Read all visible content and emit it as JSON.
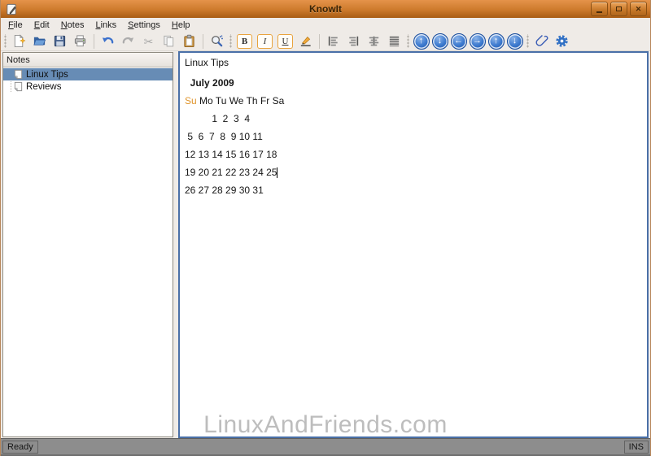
{
  "window": {
    "title": "KnowIt",
    "controls": [
      {
        "name": "minimize-button",
        "icon": "minimize-icon"
      },
      {
        "name": "maximize-button",
        "icon": "maximize-icon"
      },
      {
        "name": "close-button",
        "icon": "close-icon"
      }
    ]
  },
  "menubar": {
    "items": [
      {
        "label": "File"
      },
      {
        "label": "Edit"
      },
      {
        "label": "Notes"
      },
      {
        "label": "Links"
      },
      {
        "label": "Settings"
      },
      {
        "label": "Help"
      }
    ]
  },
  "toolbar": {
    "groups": [
      {
        "lead": "grip",
        "items": [
          {
            "name": "new-note-button",
            "icon": "new-note-icon",
            "enabled": true
          },
          {
            "name": "open-button",
            "icon": "folder-open-icon",
            "enabled": true
          },
          {
            "name": "save-button",
            "icon": "save-icon",
            "enabled": true
          },
          {
            "name": "print-button",
            "icon": "print-icon",
            "enabled": true
          }
        ]
      },
      {
        "lead": "sep",
        "items": [
          {
            "name": "undo-button",
            "icon": "undo-icon",
            "enabled": true
          },
          {
            "name": "redo-button",
            "icon": "redo-icon",
            "enabled": false
          },
          {
            "name": "cut-button",
            "icon": "cut-icon",
            "enabled": false
          },
          {
            "name": "copy-button",
            "icon": "copy-icon",
            "enabled": false
          },
          {
            "name": "paste-button",
            "icon": "paste-icon",
            "enabled": true
          }
        ]
      },
      {
        "lead": "sep",
        "items": [
          {
            "name": "find-button",
            "icon": "find-icon",
            "enabled": true
          }
        ]
      },
      {
        "lead": "grip",
        "items": [
          {
            "name": "bold-button",
            "icon": "bold-icon",
            "label": "B",
            "enabled": true,
            "toggled": true
          },
          {
            "name": "italic-button",
            "icon": "italic-icon",
            "label": "I",
            "enabled": true,
            "toggled": true
          },
          {
            "name": "underline-button",
            "icon": "underline-icon",
            "label": "U",
            "enabled": true,
            "toggled": true
          },
          {
            "name": "text-color-button",
            "icon": "pen-icon",
            "enabled": true
          }
        ]
      },
      {
        "lead": "sep",
        "items": [
          {
            "name": "align-left-button",
            "icon": "align-left-icon",
            "enabled": true
          },
          {
            "name": "align-right-button",
            "icon": "align-right-icon",
            "enabled": true
          },
          {
            "name": "align-center-button",
            "icon": "align-center-icon",
            "enabled": true
          },
          {
            "name": "align-justify-button",
            "icon": "align-justify-icon",
            "enabled": true
          }
        ]
      },
      {
        "lead": "grip",
        "items": [
          {
            "name": "nav-up-button",
            "icon": "nav-up-icon",
            "circle": true,
            "enabled": true
          },
          {
            "name": "nav-down-button",
            "icon": "nav-down-icon",
            "circle": true,
            "enabled": true
          },
          {
            "name": "nav-back-button",
            "icon": "nav-back-icon",
            "circle": true,
            "enabled": true
          },
          {
            "name": "nav-forward-button",
            "icon": "nav-forward-icon",
            "circle": true,
            "enabled": true
          },
          {
            "name": "nav-top-button",
            "icon": "nav-top-icon",
            "circle": true,
            "enabled": true
          },
          {
            "name": "nav-bottom-button",
            "icon": "nav-bottom-icon",
            "circle": true,
            "enabled": true
          }
        ]
      },
      {
        "lead": "grip",
        "items": [
          {
            "name": "attachment-button",
            "icon": "paperclip-icon",
            "enabled": true
          },
          {
            "name": "configure-button",
            "icon": "gear-icon",
            "enabled": true
          }
        ]
      }
    ]
  },
  "sidebar": {
    "header": "Notes",
    "items": [
      {
        "label": "Linux Tips",
        "selected": true
      },
      {
        "label": "Reviews",
        "selected": false
      }
    ]
  },
  "editor": {
    "note_title": "Linux Tips",
    "lines": [
      {
        "text": "  July 2009",
        "bold": true
      },
      {
        "prefix": "Su",
        "text": " Mo Tu We Th Fr Sa"
      },
      {
        "text": "          1  2  3  4"
      },
      {
        "text": " 5  6  7  8  9 10 11"
      },
      {
        "text": "12 13 14 15 16 17 18"
      },
      {
        "text": "19 20 21 22 23 24 25",
        "caret": true
      },
      {
        "text": "26 27 28 29 30 31"
      }
    ]
  },
  "statusbar": {
    "left": "Ready",
    "right": "INS"
  },
  "watermark": "LinuxAndFriends.com",
  "colors": {
    "titlebar_orange": "#cd7a2c",
    "selection_blue": "#678cb5",
    "editor_border_blue": "#4a70a8",
    "sunday_orange": "#e0962e",
    "format_toggle_orange": "#e8a33d",
    "statusbar_gray": "#8d8d8d"
  }
}
